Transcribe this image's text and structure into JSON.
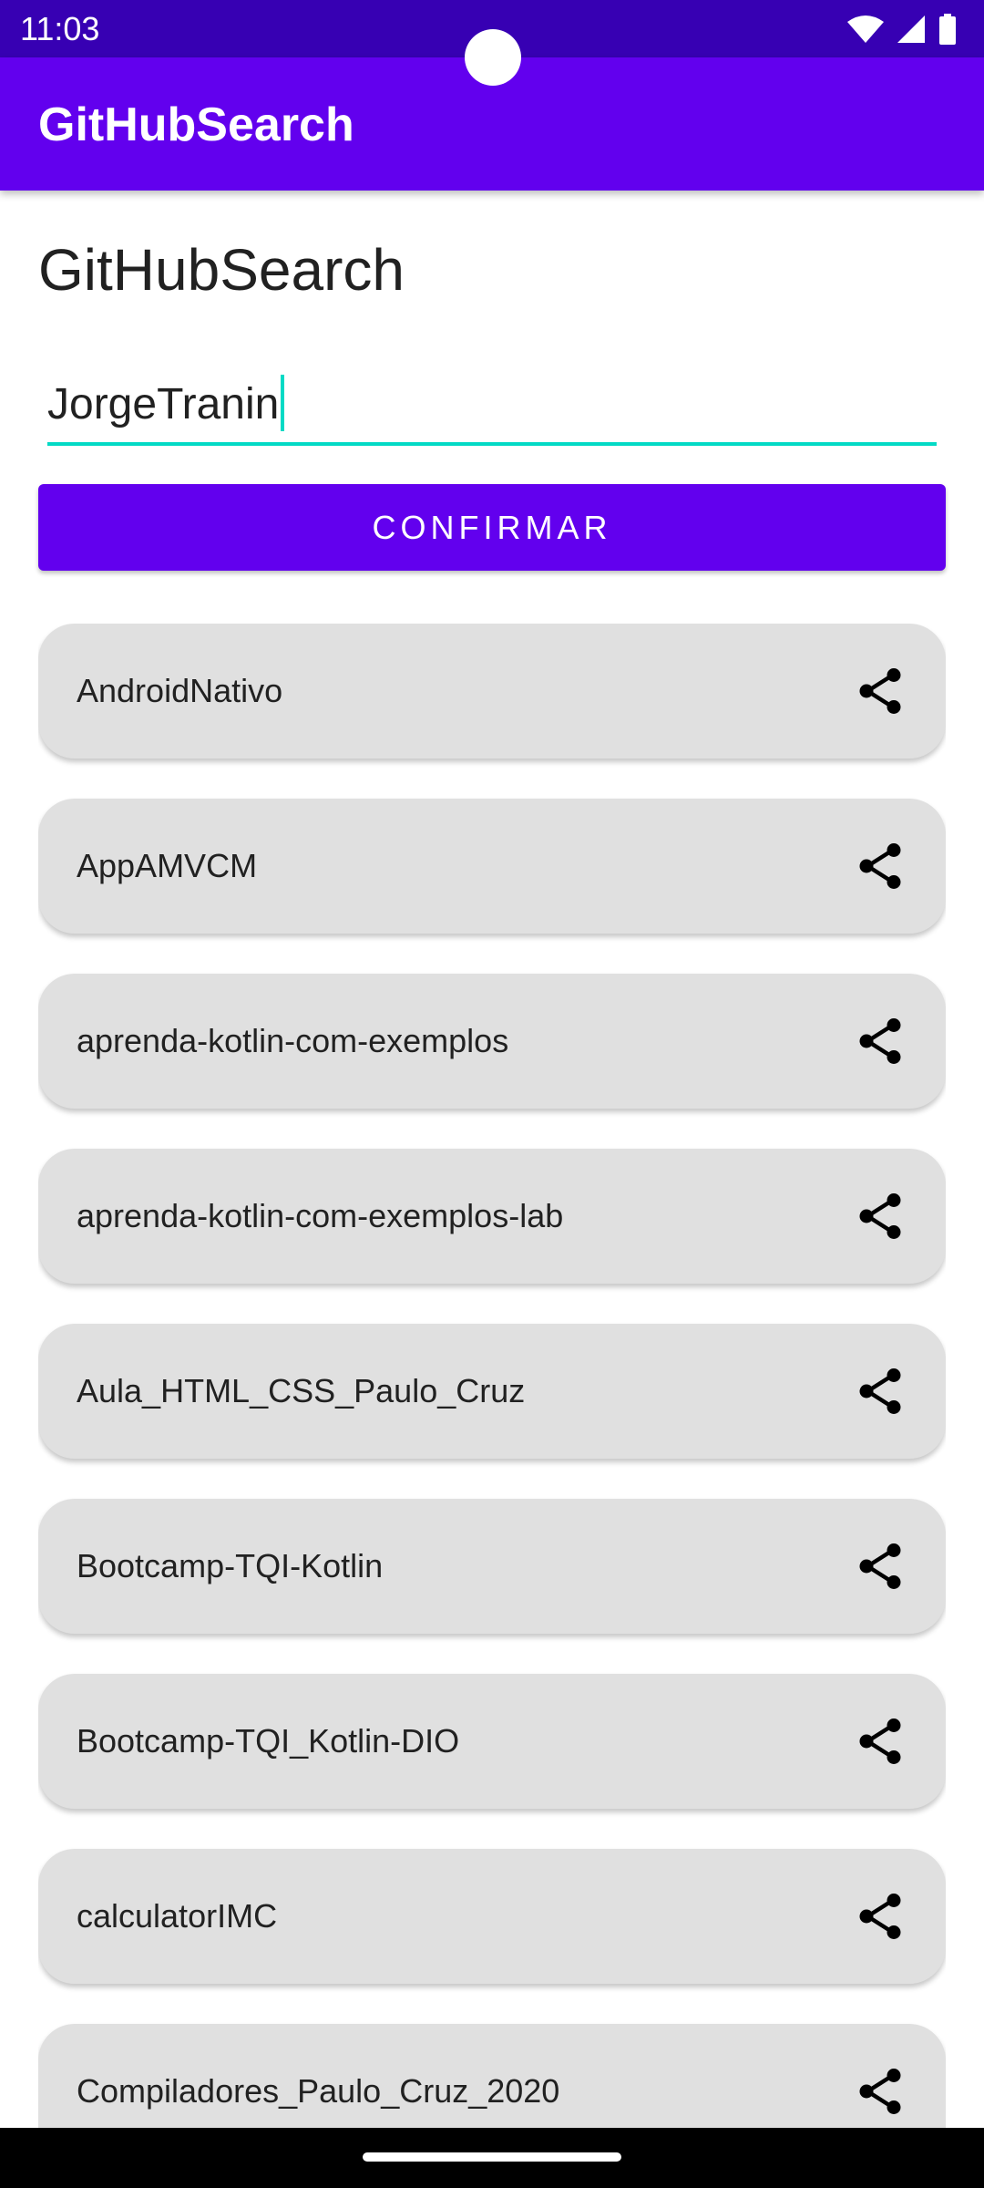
{
  "status_bar": {
    "time": "11:03",
    "icons": [
      "wifi-icon",
      "cellular-signal-icon",
      "battery-icon"
    ]
  },
  "app_bar": {
    "title": "GitHubSearch"
  },
  "main": {
    "heading": "GitHubSearch",
    "search": {
      "value": "JorgeTranin",
      "placeholder": ""
    },
    "confirm_label": "CONFIRMAR",
    "repositories": [
      {
        "name": "AndroidNativo",
        "icon": "share-icon"
      },
      {
        "name": "AppAMVCM",
        "icon": "share-icon"
      },
      {
        "name": "aprenda-kotlin-com-exemplos",
        "icon": "share-icon"
      },
      {
        "name": "aprenda-kotlin-com-exemplos-lab",
        "icon": "share-icon"
      },
      {
        "name": "Aula_HTML_CSS_Paulo_Cruz",
        "icon": "share-icon"
      },
      {
        "name": "Bootcamp-TQI-Kotlin",
        "icon": "share-icon"
      },
      {
        "name": "Bootcamp-TQI_Kotlin-DIO",
        "icon": "share-icon"
      },
      {
        "name": "calculatorIMC",
        "icon": "share-icon"
      },
      {
        "name": "Compiladores_Paulo_Cruz_2020",
        "icon": "share-icon"
      }
    ]
  },
  "colors": {
    "primary": "#6200ee",
    "primary_dark": "#3700b3",
    "accent": "#03dac5",
    "card_background": "#e0e0e0"
  }
}
